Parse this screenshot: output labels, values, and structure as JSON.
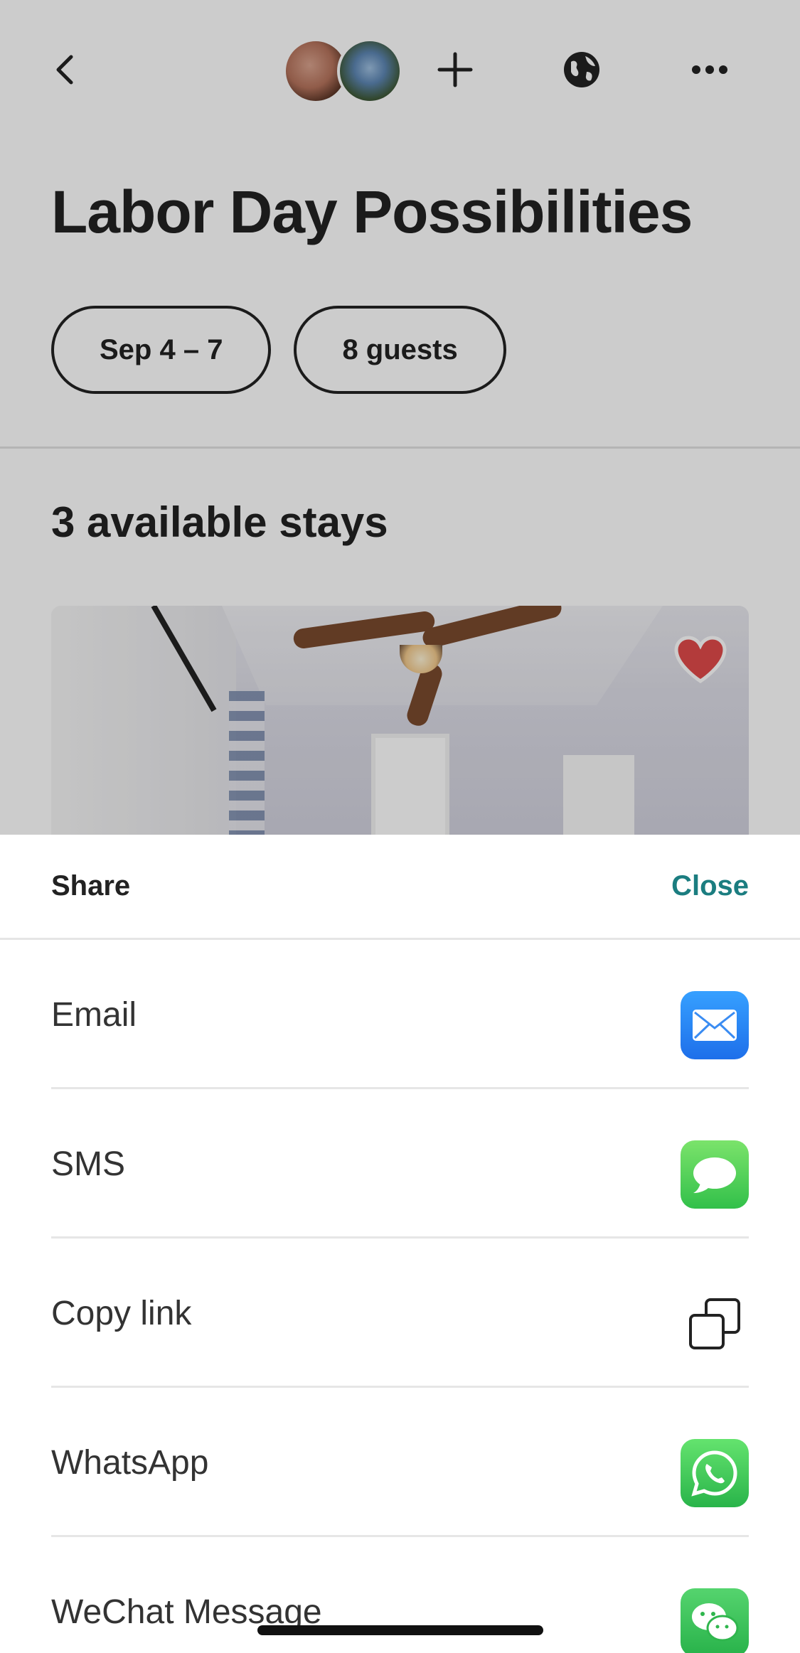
{
  "header": {
    "back_icon": "chevron-left-icon",
    "add_icon": "plus-icon",
    "globe_icon": "globe-icon",
    "more_icon": "more-horizontal-icon"
  },
  "page": {
    "title": "Labor Day Possibilities",
    "filters": {
      "dates": "Sep 4 – 7",
      "guests": "8 guests"
    },
    "stays_heading": "3 available stays",
    "listing": {
      "favorite_icon": "heart-icon",
      "favorite_color": "#e04a4a"
    }
  },
  "share_sheet": {
    "title": "Share",
    "close_label": "Close",
    "close_color": "#1b7d80",
    "options": [
      {
        "label": "Email",
        "icon": "mail-icon"
      },
      {
        "label": "SMS",
        "icon": "message-bubble-icon"
      },
      {
        "label": "Copy link",
        "icon": "copy-icon"
      },
      {
        "label": "WhatsApp",
        "icon": "whatsapp-icon"
      },
      {
        "label": "WeChat Message",
        "icon": "wechat-icon"
      }
    ]
  }
}
